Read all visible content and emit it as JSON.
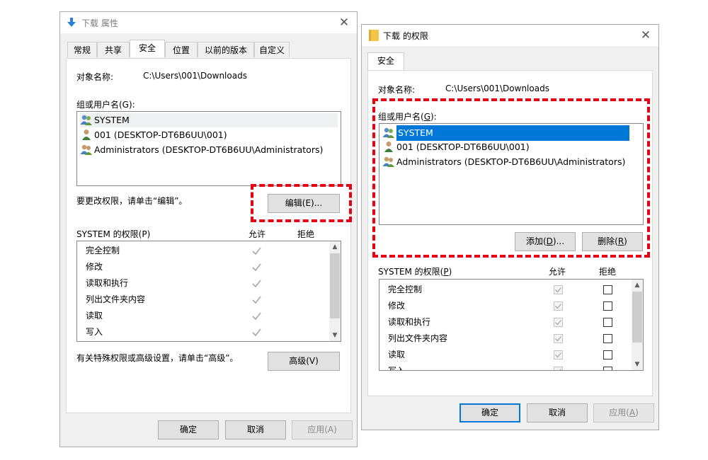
{
  "left_dialog": {
    "title": "下载 属性",
    "tabs": [
      "常规",
      "共享",
      "安全",
      "位置",
      "以前的版本",
      "自定义"
    ],
    "object_label": "对象名称:",
    "object_value": "C:\\Users\\001\\Downloads",
    "group_label": "组或用户名(G):",
    "users": [
      "SYSTEM",
      "001 (DESKTOP-DT6B6UU\\001)",
      "Administrators (DESKTOP-DT6B6UU\\Administrators)"
    ],
    "edit_hint": "要更改权限，请单击“编辑”。",
    "edit_button": "编辑(E)...",
    "perm_title": "SYSTEM 的权限(P)",
    "allow_header": "允许",
    "deny_header": "拒绝",
    "permissions": [
      "完全控制",
      "修改",
      "读取和执行",
      "列出文件夹内容",
      "读取",
      "写入"
    ],
    "advanced_hint": "有关特殊权限或高级设置，请单击“高级”。",
    "advanced_button": "高级(V)",
    "ok": "确定",
    "cancel": "取消",
    "apply": "应用(A)"
  },
  "right_dialog": {
    "title": "下载 的权限",
    "tab": "安全",
    "object_label": "对象名称:",
    "object_value": "C:\\Users\\001\\Downloads",
    "group_label_pre": "组或用户名(",
    "group_label_key": "G",
    "group_label_post": "):",
    "users": [
      "SYSTEM",
      "001 (DESKTOP-DT6B6UU\\001)",
      "Administrators (DESKTOP-DT6B6UU\\Administrators)"
    ],
    "add_pre": "添加(",
    "add_key": "D",
    "add_post": ")...",
    "remove_pre": "删除(",
    "remove_key": "R",
    "remove_post": ")",
    "perm_title_pre": "SYSTEM 的权限(",
    "perm_title_key": "P",
    "perm_title_post": ")",
    "allow_header": "允许",
    "deny_header": "拒绝",
    "permissions": [
      "完全控制",
      "修改",
      "读取和执行",
      "列出文件夹内容",
      "读取",
      "写入"
    ],
    "ok": "确定",
    "cancel": "取消",
    "apply_pre": "应用(",
    "apply_key": "A",
    "apply_post": ")"
  },
  "colors": {
    "highlight": "#e60012",
    "selection": "#0078d7"
  }
}
